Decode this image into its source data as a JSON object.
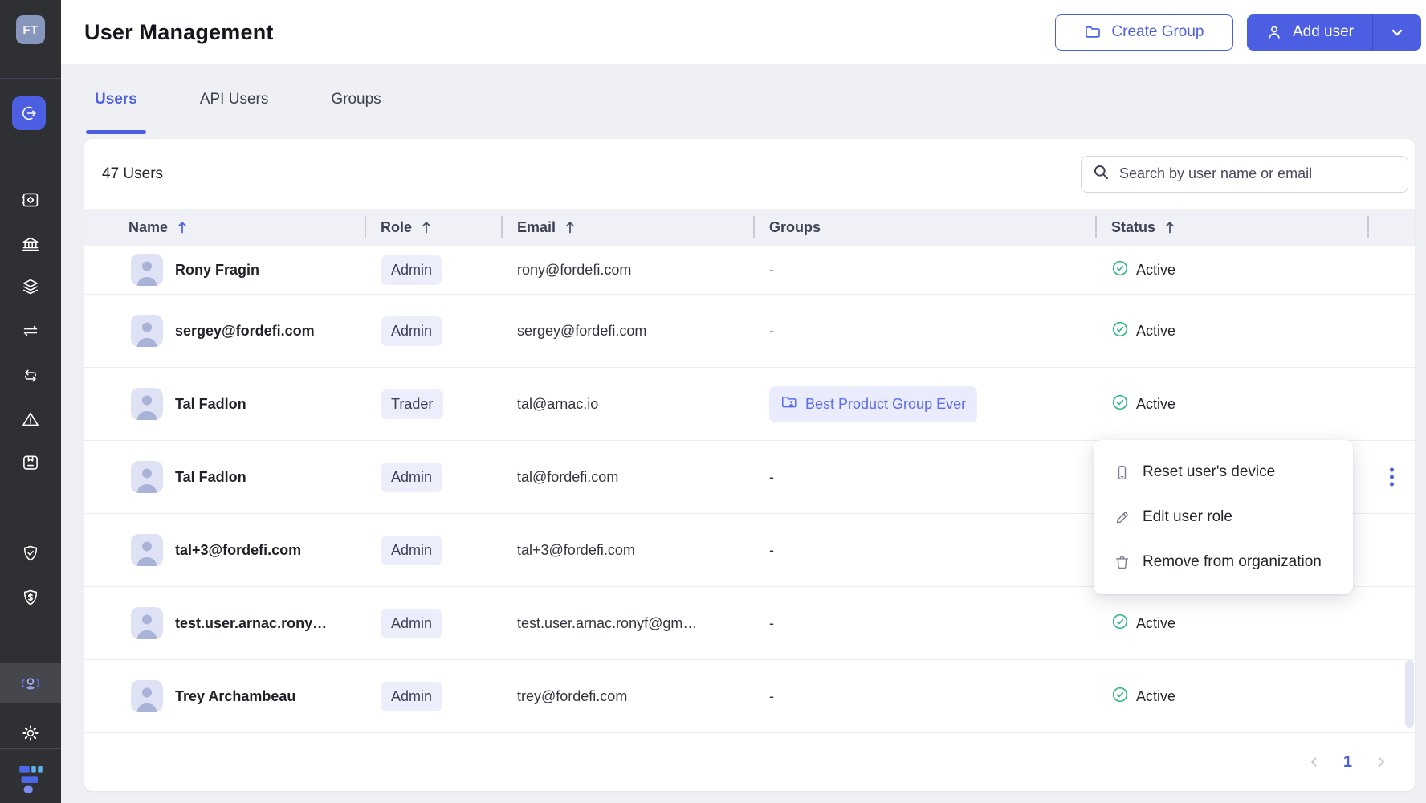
{
  "colors": {
    "accent": "#4c5fe2",
    "accent_soft": "#eceefb",
    "chip_text": "#5b6cf0",
    "green": "#35b888",
    "sidebar_bg": "#2f3034",
    "sidebar_active_bg": "#46474c",
    "page_bg": "#eef0f4",
    "avatar_bg": "#8796bd"
  },
  "sidebar": {
    "avatar_initials": "FT",
    "items": [
      {
        "name": "logout"
      },
      {
        "name": "vault"
      },
      {
        "name": "bank"
      },
      {
        "name": "layers"
      },
      {
        "name": "transfer"
      },
      {
        "name": "loop"
      },
      {
        "name": "warning"
      },
      {
        "name": "package"
      },
      {
        "name": "shield-check"
      },
      {
        "name": "shield-dollar"
      },
      {
        "name": "users",
        "active": true
      },
      {
        "name": "settings"
      }
    ]
  },
  "header": {
    "title": "User Management",
    "create_group_label": "Create Group",
    "add_user_label": "Add user"
  },
  "tabs": [
    {
      "label": "Users",
      "active": true
    },
    {
      "label": "API Users",
      "active": false
    },
    {
      "label": "Groups",
      "active": false
    }
  ],
  "toolbar": {
    "users_count": "47 Users",
    "search_placeholder": "Search by user name or email"
  },
  "table": {
    "columns": [
      {
        "label": "Name",
        "sortable": true,
        "sort_active": true
      },
      {
        "label": "Role",
        "sortable": true,
        "sort_active": false
      },
      {
        "label": "Email",
        "sortable": true,
        "sort_active": false
      },
      {
        "label": "Groups",
        "sortable": false,
        "sort_active": false
      },
      {
        "label": "Status",
        "sortable": true,
        "sort_active": false
      }
    ],
    "rows": [
      {
        "name": "Rony Fragin",
        "role": "Admin",
        "email": "rony@fordefi.com",
        "groups": "-",
        "groups_chip": false,
        "status": "Active",
        "menu_open": false
      },
      {
        "name": "sergey@fordefi.com",
        "role": "Admin",
        "email": "sergey@fordefi.com",
        "groups": "-",
        "groups_chip": false,
        "status": "Active",
        "menu_open": false
      },
      {
        "name": "Tal Fadlon",
        "role": "Trader",
        "email": "tal@arnac.io",
        "groups": "Best Product Group Ever",
        "groups_chip": true,
        "status": "Active",
        "menu_open": false
      },
      {
        "name": "Tal Fadlon",
        "role": "Admin",
        "email": "tal@fordefi.com",
        "groups": "-",
        "groups_chip": false,
        "status": "",
        "menu_open": true
      },
      {
        "name": "tal+3@fordefi.com",
        "role": "Admin",
        "email": "tal+3@fordefi.com",
        "groups": "-",
        "groups_chip": false,
        "status": "",
        "menu_open": false
      },
      {
        "name": "test.user.arnac.rony…",
        "role": "Admin",
        "email": "test.user.arnac.ronyf@gm…",
        "groups": "-",
        "groups_chip": false,
        "status": "Active",
        "menu_open": false
      },
      {
        "name": "Trey Archambeau",
        "role": "Admin",
        "email": "trey@fordefi.com",
        "groups": "-",
        "groups_chip": false,
        "status": "Active",
        "menu_open": false
      }
    ]
  },
  "context_menu": {
    "items": [
      {
        "icon": "device-icon",
        "label": "Reset user's device"
      },
      {
        "icon": "edit-icon",
        "label": "Edit user role"
      },
      {
        "icon": "trash-icon",
        "label": "Remove from organization"
      }
    ]
  },
  "pagination": {
    "current_page": "1"
  }
}
